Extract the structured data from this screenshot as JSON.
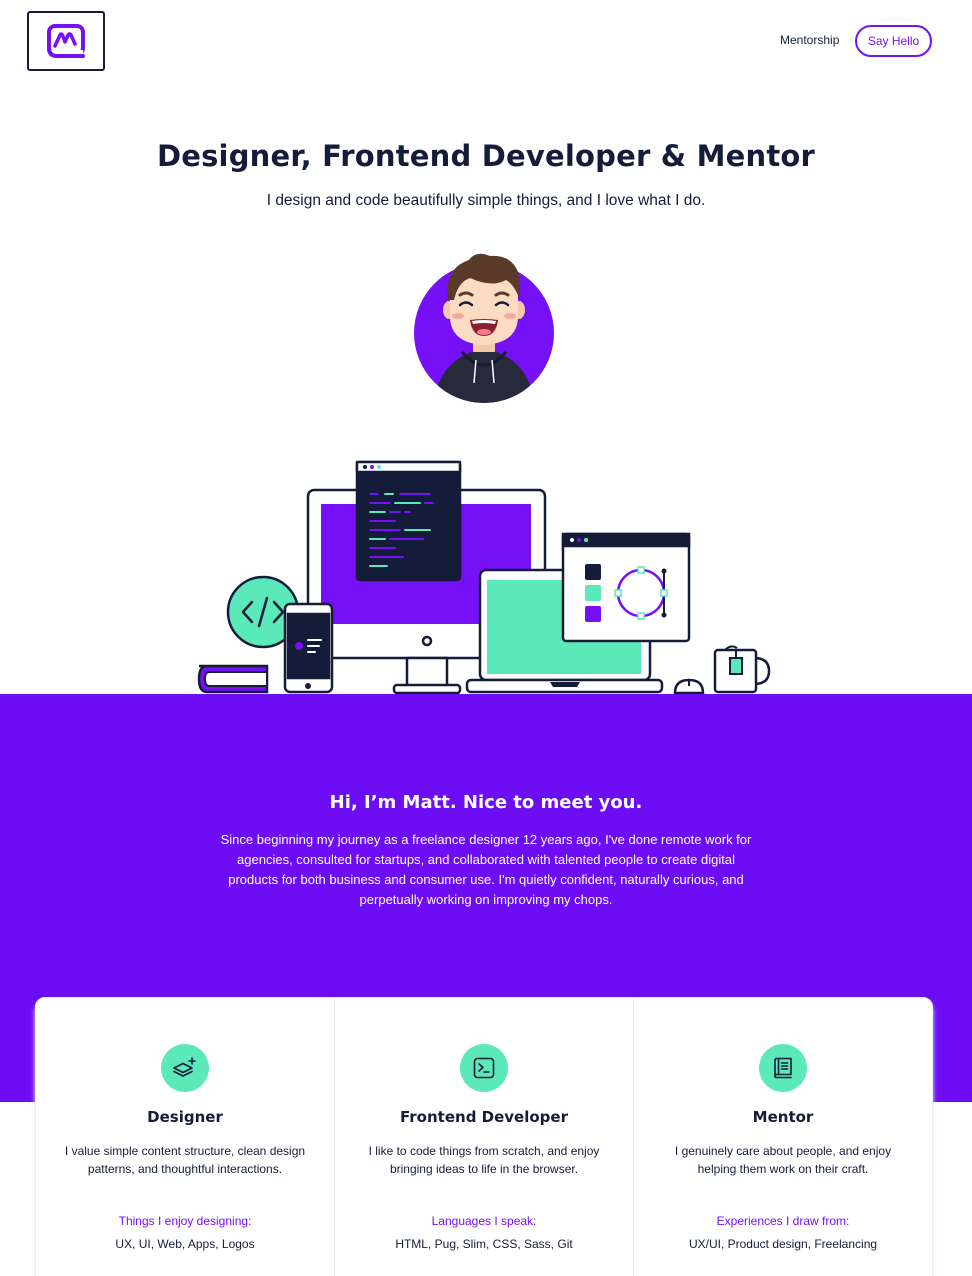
{
  "nav": {
    "mentorship_label": "Mentorship",
    "say_hello_label": "Say Hello"
  },
  "hero": {
    "title": "Designer, Frontend Developer & Mentor",
    "subtitle": "I design and code beautifully simple things, and I love what I do."
  },
  "intro": {
    "title": "Hi, I’m Matt. Nice to meet you.",
    "text": "Since beginning my journey as a freelance designer 12 years ago, I've done remote work for agencies, consulted for startups, and collaborated with talented people to create digital products for both business and consumer use. I'm quietly confident, naturally curious, and perpetually working on improving my chops."
  },
  "cards": [
    {
      "icon": "layers-plus-icon",
      "title": "Designer",
      "text": "I value simple content structure, clean design patterns, and thoughtful interactions.",
      "sub_label": "Things I enjoy designing:",
      "list": "UX, UI, Web, Apps, Logos"
    },
    {
      "icon": "terminal-icon",
      "title": "Frontend Developer",
      "text": "I like to code things from scratch, and enjoy bringing ideas to life in the browser.",
      "sub_label": "Languages I speak:",
      "list": "HTML, Pug, Slim, CSS, Sass, Git"
    },
    {
      "icon": "book-icon",
      "title": "Mentor",
      "text": "I genuinely care about people, and enjoy helping them work on their craft.",
      "sub_label": "Experiences I draw from:",
      "list": "UX/UI, Product design, Freelancing"
    }
  ],
  "colors": {
    "accent": "#7510f7",
    "section_bg": "#6d0df4",
    "mint": "#5be9b9",
    "navy": "#141c3a"
  }
}
